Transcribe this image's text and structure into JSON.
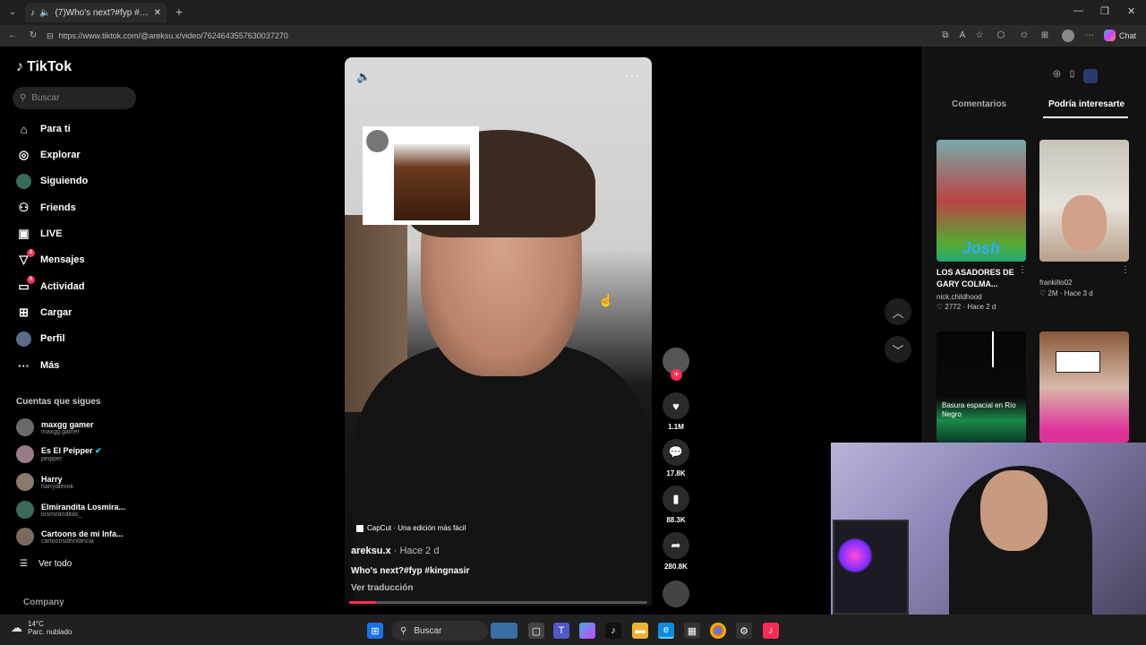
{
  "browser": {
    "tab_title": "(7)Who's next?#fyp #kingnas",
    "url": "https://www.tiktok.com/@areksu.x/video/7624643557630037270",
    "chat_label": "Chat"
  },
  "sidebar": {
    "logo": "TikTok",
    "search_placeholder": "Buscar",
    "nav": [
      {
        "label": "Para ti",
        "icon": "home-icon"
      },
      {
        "label": "Explorar",
        "icon": "compass-icon"
      },
      {
        "label": "Siguiendo",
        "icon": "following-avatar-icon"
      },
      {
        "label": "Friends",
        "icon": "friends-icon"
      },
      {
        "label": "LIVE",
        "icon": "live-icon"
      },
      {
        "label": "Mensajes",
        "icon": "messages-icon",
        "badge": "2"
      },
      {
        "label": "Actividad",
        "icon": "activity-icon",
        "badge": "5"
      },
      {
        "label": "Cargar",
        "icon": "upload-icon"
      },
      {
        "label": "Perfil",
        "icon": "profile-avatar-icon"
      },
      {
        "label": "Más",
        "icon": "more-icon"
      }
    ],
    "following_title": "Cuentas que sigues",
    "following": [
      {
        "name": "maxgg gamer",
        "user": "maxgg.gamer",
        "verified": false
      },
      {
        "name": "Es El Peipper",
        "user": "peipper",
        "verified": true
      },
      {
        "name": "Harry",
        "user": "harryalexok",
        "verified": false
      },
      {
        "name": "Elmirandita Losmira...",
        "user": "losmiranditas_",
        "verified": false
      },
      {
        "name": "Cartoons de mi Infa...",
        "user": "cartoonsdeinfancia",
        "verified": false
      }
    ],
    "see_all": "Ver todo",
    "company": "Company"
  },
  "video": {
    "capcut": "CapCut · Una edición más fácil",
    "author": "areksu.x",
    "time": "· Hace 2 d",
    "caption": "Who's next?#fyp #kingnasir",
    "translate": "Ver traducción",
    "progress": 0.09,
    "likes": "1.1M",
    "comments": "17.8K",
    "saves": "88.3K",
    "shares": "280.8K"
  },
  "right_panel": {
    "tab_comments": "Comentarios",
    "tab_suggested": "Podría interesarte",
    "cards": [
      {
        "title": "LOS ASADORES DE GARY COLMA...",
        "user": "nick.childhood",
        "likes": "2772",
        "time": "Hace 2 d",
        "thumb_text": "Josh"
      },
      {
        "title": "",
        "user": "frankillo02",
        "likes": "2M",
        "time": "Hace 3 d",
        "thumb_text": ""
      },
      {
        "title": "",
        "user": "",
        "likes": "",
        "time": "",
        "thumb_text": "Basura espacial en Río Negro"
      },
      {
        "title": "",
        "user": "",
        "likes": "",
        "time": "",
        "thumb_text": ""
      }
    ]
  },
  "taskbar": {
    "temp": "14°C",
    "weather": "Parc. nublado",
    "search": "Buscar"
  }
}
